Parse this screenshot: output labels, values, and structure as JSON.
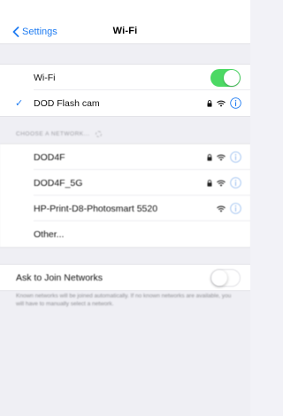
{
  "navbar": {
    "back_label": "Settings",
    "title": "Wi-Fi"
  },
  "wifi_toggle": {
    "label": "Wi-Fi",
    "state": "on"
  },
  "connected_network": {
    "name": "DOD Flash cam",
    "secured": true,
    "selected": true
  },
  "section": {
    "header": "CHOOSE A NETWORK..."
  },
  "networks": [
    {
      "name": "DOD4F",
      "secured": true
    },
    {
      "name": "DOD4F_5G",
      "secured": true
    },
    {
      "name": "HP-Print-D8-Photosmart 5520",
      "secured": false
    },
    {
      "name": "Other...",
      "secured": false
    }
  ],
  "ask_to_join": {
    "label": "Ask to Join Networks",
    "state": "off",
    "note": "Known networks will be joined automatically. If no known networks are available, you will have to manually select a network."
  },
  "colors": {
    "accent": "#1f7cf2",
    "toggle_on": "#4cd964",
    "background": "#efeff4"
  },
  "icons": {
    "back": "chevron-left-icon",
    "check": "checkmark-icon",
    "lock": "lock-icon",
    "wifi": "wifi-icon",
    "info": "info-icon",
    "spinner": "spinner-icon"
  }
}
